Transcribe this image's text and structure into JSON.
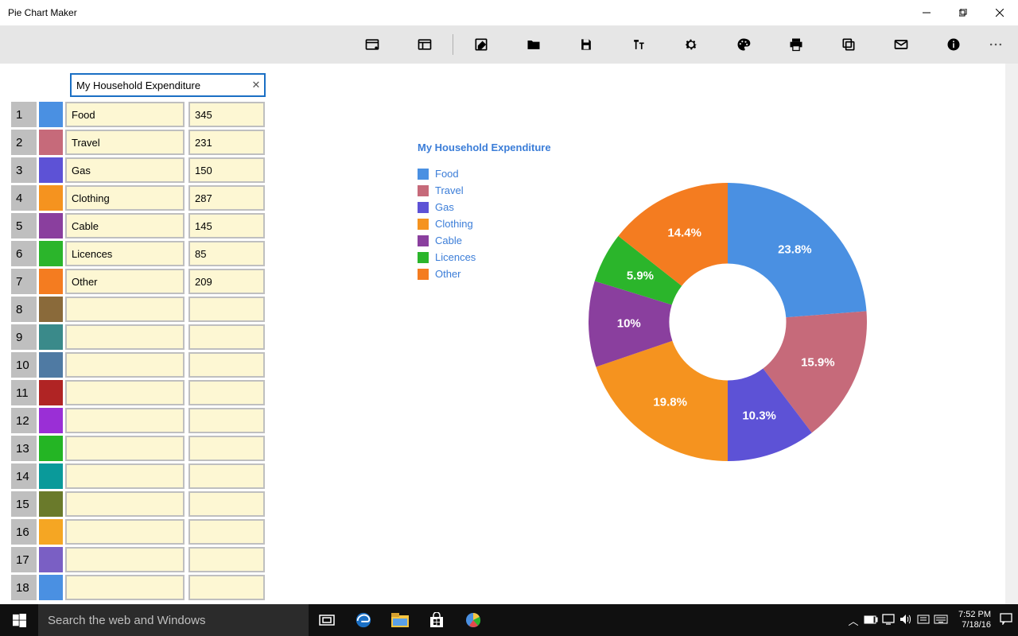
{
  "window": {
    "title": "Pie Chart Maker"
  },
  "toolbar_icons": [
    "window-layout",
    "panel",
    "edit",
    "folder",
    "save",
    "text",
    "settings",
    "palette",
    "print",
    "copy",
    "mail",
    "info",
    "more"
  ],
  "title_input": {
    "value": "My Household Expenditure"
  },
  "rows": [
    {
      "n": "1",
      "color": "#4a90e2",
      "label": "Food",
      "value": "345"
    },
    {
      "n": "2",
      "color": "#c66a7a",
      "label": "Travel",
      "value": "231"
    },
    {
      "n": "3",
      "color": "#5d52d6",
      "label": "Gas",
      "value": "150"
    },
    {
      "n": "4",
      "color": "#f5931f",
      "label": "Clothing",
      "value": "287"
    },
    {
      "n": "5",
      "color": "#8a3f9e",
      "label": "Cable",
      "value": "145"
    },
    {
      "n": "6",
      "color": "#2bb52b",
      "label": "Licences",
      "value": "85"
    },
    {
      "n": "7",
      "color": "#f47c20",
      "label": "Other",
      "value": "209"
    },
    {
      "n": "8",
      "color": "#8a6a3a",
      "label": "",
      "value": ""
    },
    {
      "n": "9",
      "color": "#3a8a8a",
      "label": "",
      "value": ""
    },
    {
      "n": "10",
      "color": "#4f7aa3",
      "label": "",
      "value": ""
    },
    {
      "n": "11",
      "color": "#b02424",
      "label": "",
      "value": ""
    },
    {
      "n": "12",
      "color": "#9a2fd6",
      "label": "",
      "value": ""
    },
    {
      "n": "13",
      "color": "#24b524",
      "label": "",
      "value": ""
    },
    {
      "n": "14",
      "color": "#0a9a9a",
      "label": "",
      "value": ""
    },
    {
      "n": "15",
      "color": "#6a7a2b",
      "label": "",
      "value": ""
    },
    {
      "n": "16",
      "color": "#f5a623",
      "label": "",
      "value": ""
    },
    {
      "n": "17",
      "color": "#7a5fc4",
      "label": "",
      "value": ""
    },
    {
      "n": "18",
      "color": "#4a90e2",
      "label": "",
      "value": ""
    }
  ],
  "chart_data": {
    "type": "pie",
    "title": "My Household Expenditure",
    "series": [
      {
        "name": "Food",
        "value": 345,
        "pct": "23.8%",
        "color": "#4a90e2"
      },
      {
        "name": "Travel",
        "value": 231,
        "pct": "15.9%",
        "color": "#c66a7a"
      },
      {
        "name": "Gas",
        "value": 150,
        "pct": "10.3%",
        "color": "#5d52d6"
      },
      {
        "name": "Clothing",
        "value": 287,
        "pct": "19.8%",
        "color": "#f5931f"
      },
      {
        "name": "Cable",
        "value": 145,
        "pct": "10%",
        "color": "#8a3f9e"
      },
      {
        "name": "Licences",
        "value": 85,
        "pct": "5.9%",
        "color": "#2bb52b"
      },
      {
        "name": "Other",
        "value": 209,
        "pct": "14.4%",
        "color": "#f47c20"
      }
    ],
    "inner_radius_ratio": 0.42
  },
  "taskbar": {
    "search_placeholder": "Search the web and Windows",
    "time": "7:52 PM",
    "date": "7/18/16"
  }
}
